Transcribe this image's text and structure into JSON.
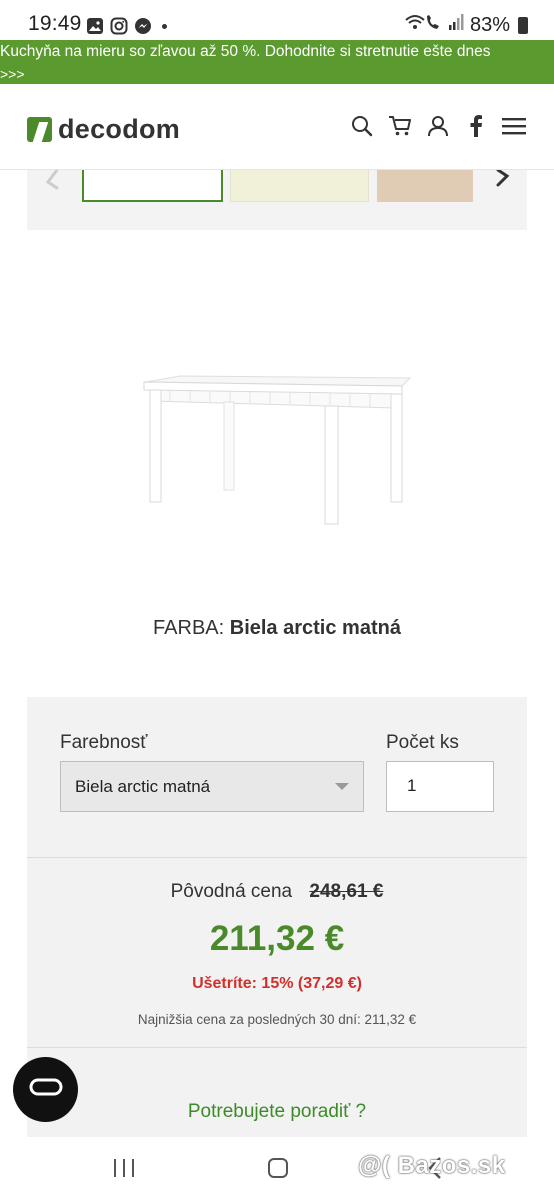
{
  "status_bar": {
    "time": "19:49",
    "battery": "83%",
    "icons": [
      "gallery-icon",
      "instagram-icon",
      "messenger-icon",
      "wifi-call-icon",
      "signal-icon",
      "battery-icon"
    ]
  },
  "promo": {
    "text": "Kuchyňa na mieru so zľavou až 50 %. Dohodnite si stretnutie ešte dnes",
    "more": ">>>",
    "bg_color": "#5b9a2f"
  },
  "header": {
    "logo_text": "decodom",
    "icons": [
      "search-icon",
      "cart-icon",
      "user-icon",
      "facebook-icon",
      "menu-icon"
    ]
  },
  "gallery": {
    "thumbnail_colors": [
      "#ffffff",
      "#f1f0d8",
      "#e0cbb4"
    ],
    "selected_index": 0
  },
  "product": {
    "color_label": "FARBA:",
    "color_value": "Biela arctic matná"
  },
  "options": {
    "color_label": "Farebnosť",
    "color_selected": "Biela arctic matná",
    "qty_label": "Počet ks",
    "qty_value": "1"
  },
  "pricing": {
    "old_label": "Pôvodná cena",
    "old_price": "248,61 €",
    "new_price": "211,32 €",
    "savings": "Ušetríte: 15% (37,29 €)",
    "lowest_price_note": "Najnižšia cena za posledných 30 dní: 211,32 €",
    "accent_green": "#4a8a2a",
    "accent_red": "#d0312d"
  },
  "help": {
    "advice_text": "Potrebujete poradiť ?"
  },
  "watermark": "@( Bazos.sk"
}
